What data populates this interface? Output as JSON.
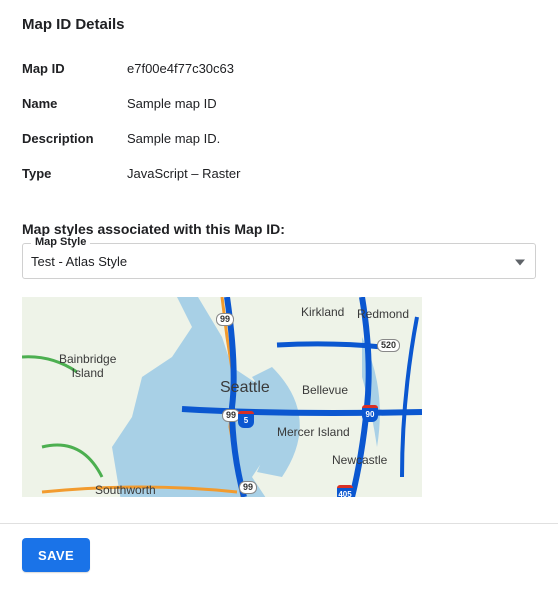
{
  "section_title": "Map ID Details",
  "details": {
    "map_id": {
      "label": "Map ID",
      "value": "e7f00e4f77c30c63"
    },
    "name": {
      "label": "Name",
      "value": "Sample map ID"
    },
    "description": {
      "label": "Description",
      "value": "Sample map ID."
    },
    "type": {
      "label": "Type",
      "value": "JavaScript – Raster"
    }
  },
  "assoc_title": "Map styles associated with this Map ID:",
  "style_select": {
    "legend": "Map Style",
    "value": "Test - Atlas Style"
  },
  "map_labels": {
    "seattle": "Seattle",
    "bellevue": "Bellevue",
    "kirkland": "Kirkland",
    "redmond": "Redmond",
    "mercer_island": "Mercer Island",
    "newcastle": "Newcastle",
    "bainbridge_island": "Bainbridge Island",
    "southworth": "Southworth"
  },
  "map_shields": {
    "us99_a": "99",
    "us99_b": "99",
    "us99_c": "99",
    "i5": "5",
    "i90": "90",
    "sr520": "520",
    "i405": "405"
  },
  "save_label": "SAVE"
}
